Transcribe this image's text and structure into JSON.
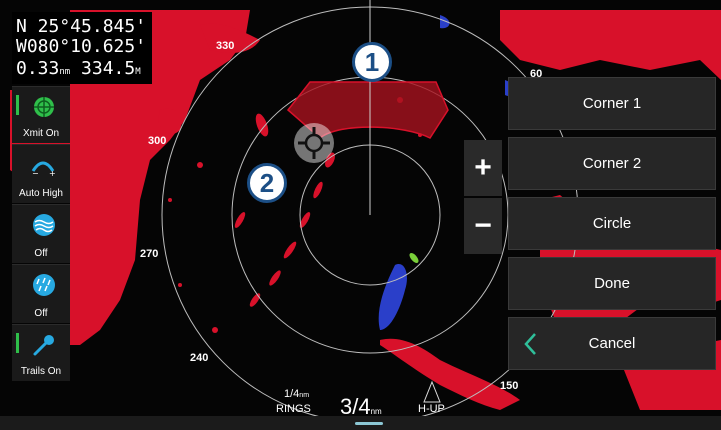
{
  "coords": {
    "lat": "N 25°45.845'",
    "lon": "W080°10.625'",
    "dist_value": "0.33",
    "dist_unit": "nm",
    "bearing_value": "334.5",
    "bearing_unit": "M"
  },
  "left_controls": [
    {
      "label": "Xmit On",
      "icon": "radar-transmit-icon"
    },
    {
      "label": "Auto High",
      "icon": "gain-icon"
    },
    {
      "label": "Off",
      "icon": "sea-clutter-icon"
    },
    {
      "label": "Off",
      "icon": "rain-clutter-icon"
    },
    {
      "label": "Trails On",
      "icon": "trails-icon"
    }
  ],
  "menu": {
    "corner1": "Corner 1",
    "corner2": "Corner 2",
    "circle": "Circle",
    "done": "Done",
    "cancel": "Cancel"
  },
  "zoom": {
    "plus": "+",
    "minus": "−"
  },
  "bearings": [
    "330",
    "300",
    "270",
    "240",
    "60",
    "150"
  ],
  "range": {
    "rings_value": "1/4",
    "rings_unit": "nm",
    "rings_label": "RINGS",
    "range_value": "3/4",
    "range_unit": "nm",
    "orientation": "H-UP"
  },
  "callouts": [
    "1",
    "2"
  ],
  "colors": {
    "echo": "#d8112a",
    "zone": "#a8121e",
    "accent_green": "#2fbf4a"
  }
}
